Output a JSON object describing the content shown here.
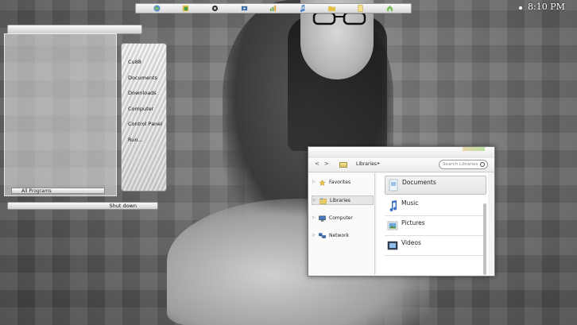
{
  "clock": {
    "time": "8:10 PM"
  },
  "dock": {
    "icons": [
      "globe-icon",
      "paint-icon",
      "settings-icon",
      "media-icon",
      "chart-icon",
      "music-icon",
      "folder-icon",
      "notes-icon",
      "home-icon"
    ]
  },
  "start_menu": {
    "items": [
      "Cu88",
      "Documents",
      "Downloads",
      "Computer",
      "Control Panel",
      "Run..."
    ],
    "all_programs": "All Programs",
    "shutdown": "Shut down"
  },
  "explorer": {
    "back": "<",
    "forward": ">",
    "breadcrumb": "Libraries",
    "breadcrumb_arrow": "▸",
    "search_placeholder": "Search Libraries",
    "nav": [
      "Favorites",
      "Libraries",
      "Computer",
      "Network"
    ],
    "libraries": [
      "Documents",
      "Music",
      "Pictures",
      "Videos"
    ]
  }
}
